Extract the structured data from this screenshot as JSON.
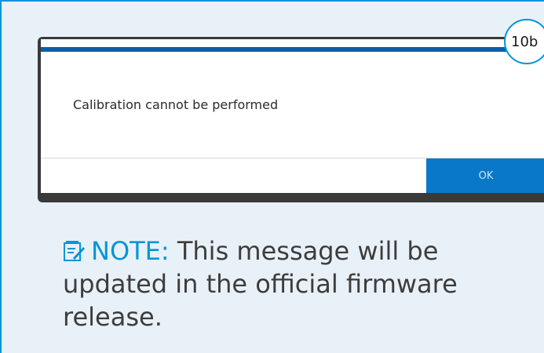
{
  "dialog": {
    "message": "Calibration cannot be performed",
    "ok_label": "OK"
  },
  "callout": {
    "label": "10b"
  },
  "note": {
    "icon": "note-icon",
    "label": "NOTE:",
    "text": " This message will be updated in the official firmware release."
  },
  "colors": {
    "accent": "#0096d6",
    "button": "#0a78c8",
    "dialog_bar": "#0a5fa8",
    "panel_bg": "#e9f1f8",
    "frame": "#3a3a3a"
  }
}
